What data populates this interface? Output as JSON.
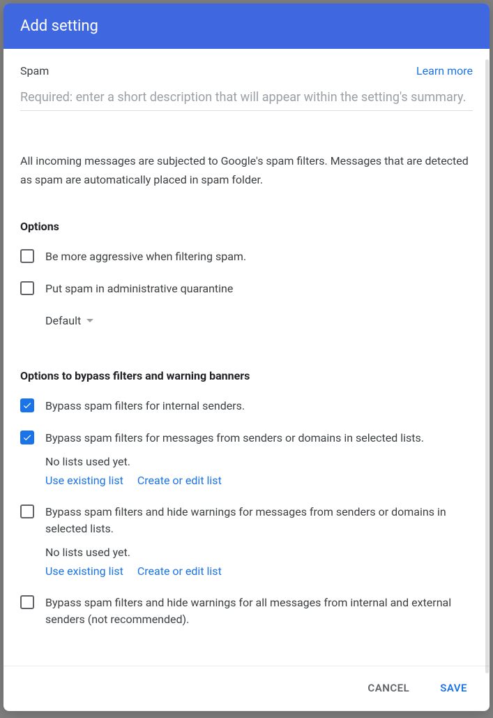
{
  "dialog": {
    "title": "Add setting"
  },
  "top": {
    "section": "Spam",
    "learn_more": "Learn more"
  },
  "desc_placeholder": "Required: enter a short description that will appear within the setting's summary.",
  "intro": "All incoming messages are subjected to Google's spam filters. Messages that are detected as spam are automatically placed in spam folder.",
  "options_title": "Options",
  "options": [
    {
      "label": "Be more aggressive when filtering spam.",
      "checked": false
    },
    {
      "label": "Put spam in administrative quarantine",
      "checked": false
    }
  ],
  "quarantine_dropdown": "Default",
  "bypass_title": "Options to bypass filters and warning banners",
  "bypass": [
    {
      "label": "Bypass spam filters for internal senders.",
      "checked": true,
      "has_lists": false
    },
    {
      "label": "Bypass spam filters for messages from senders or domains in selected lists.",
      "checked": true,
      "has_lists": true
    },
    {
      "label": "Bypass spam filters and hide warnings for messages from senders or domains in selected lists.",
      "checked": false,
      "has_lists": true
    },
    {
      "label": "Bypass spam filters and hide warnings for all messages from internal and external senders (not recommended).",
      "checked": false,
      "has_lists": false
    }
  ],
  "lists": {
    "empty": "No lists used yet.",
    "use_existing": "Use existing list",
    "create_edit": "Create or edit list"
  },
  "footer": {
    "cancel": "CANCEL",
    "save": "SAVE"
  }
}
